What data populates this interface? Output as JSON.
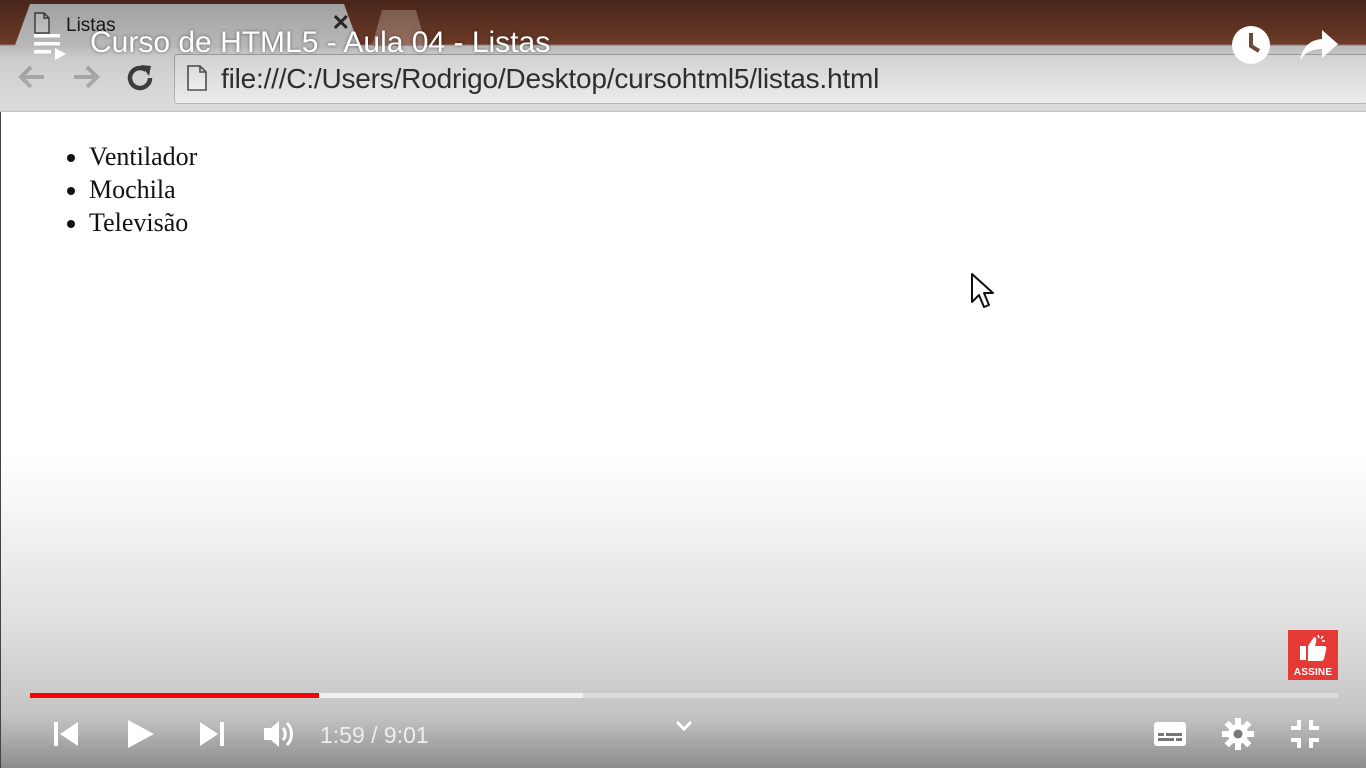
{
  "browser": {
    "tab_title": "Listas",
    "tab_close": "✕",
    "url": "file:///C:/Users/Rodrigo/Desktop/cursohtml5/listas.html"
  },
  "page": {
    "list_items": [
      "Ventilador",
      "Mochila",
      "Televisão"
    ]
  },
  "player": {
    "video_title": "Curso de HTML5 - Aula 04 - Listas",
    "current_time": "1:59",
    "duration": "9:01",
    "time_display": "1:59 / 9:01",
    "progress_fraction": 0.221,
    "buffered_fraction": 0.423,
    "accent_color": "#ff0000"
  },
  "subscribe_badge": {
    "label": "ASSINE",
    "color": "#e53935"
  },
  "icons": {
    "playlist": "playlist-icon",
    "watch_later": "clock-icon",
    "share": "share-arrow-icon",
    "previous": "skip-previous-icon",
    "play": "play-icon",
    "next": "skip-next-icon",
    "volume": "volume-icon",
    "subtitles": "subtitles-icon",
    "settings": "gear-icon",
    "exit_fullscreen": "exit-fullscreen-icon"
  }
}
